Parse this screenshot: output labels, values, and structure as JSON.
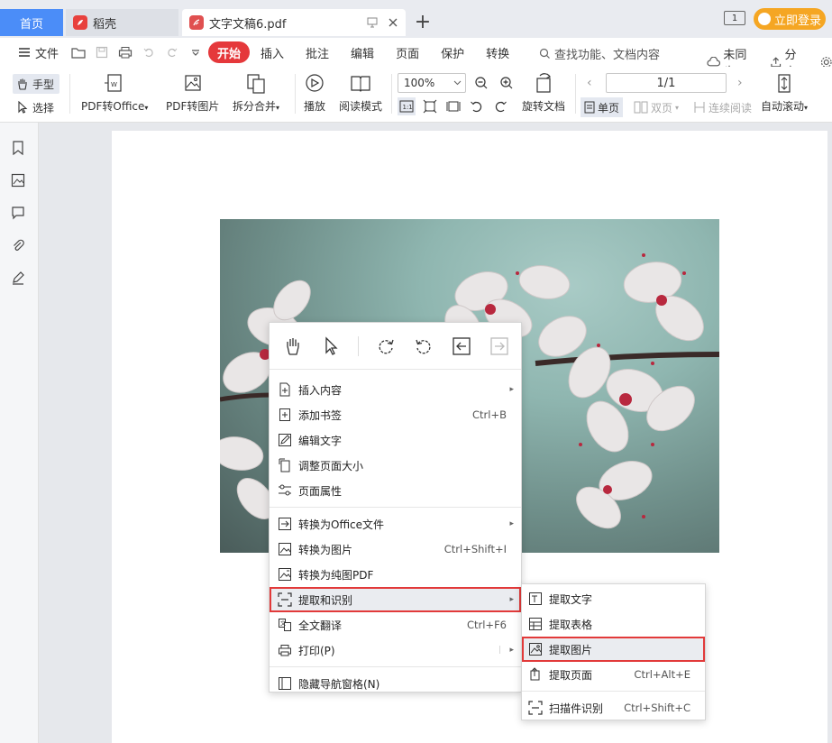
{
  "tabs": {
    "home": "首页",
    "daoke": "稻壳",
    "doc": "文字文稿6.pdf",
    "badge": "1",
    "login": "立即登录"
  },
  "menu": {
    "file": "文件",
    "tabs": [
      "开始",
      "插入",
      "批注",
      "编辑",
      "页面",
      "保护",
      "转换"
    ],
    "search": "查找功能、文档内容",
    "sync": "未同步",
    "share": "分享"
  },
  "toolbar": {
    "hand": "手型",
    "select": "选择",
    "pdf_to_office": "PDF转Office",
    "pdf_to_image": "PDF转图片",
    "split_merge": "拆分合并",
    "play": "播放",
    "read_mode": "阅读模式",
    "zoom": "100%",
    "rotate": "旋转文档",
    "page": "1/1",
    "single": "单页",
    "double": "双页",
    "continuous": "连续阅读",
    "auto_scroll": "自动滚动"
  },
  "context_menu": {
    "items": [
      {
        "label": "插入内容",
        "shortcut": "",
        "arrow": true
      },
      {
        "label": "添加书签",
        "shortcut": "Ctrl+B",
        "arrow": false
      },
      {
        "label": "编辑文字",
        "shortcut": "",
        "arrow": false
      },
      {
        "label": "调整页面大小",
        "shortcut": "",
        "arrow": false
      },
      {
        "label": "页面属性",
        "shortcut": "",
        "arrow": false
      },
      {
        "label": "转换为Office文件",
        "shortcut": "",
        "arrow": true
      },
      {
        "label": "转换为图片",
        "shortcut": "Ctrl+Shift+I",
        "arrow": false
      },
      {
        "label": "转换为纯图PDF",
        "shortcut": "",
        "arrow": false
      },
      {
        "label": "提取和识别",
        "shortcut": "",
        "arrow": true
      },
      {
        "label": "全文翻译",
        "shortcut": "Ctrl+F6",
        "arrow": false
      },
      {
        "label": "打印(P)",
        "shortcut": "",
        "arrow": true
      },
      {
        "label": "隐藏导航窗格(N)",
        "shortcut": "",
        "arrow": false
      }
    ]
  },
  "submenu": {
    "items": [
      {
        "label": "提取文字",
        "shortcut": ""
      },
      {
        "label": "提取表格",
        "shortcut": ""
      },
      {
        "label": "提取图片",
        "shortcut": ""
      },
      {
        "label": "提取页面",
        "shortcut": "Ctrl+Alt+E"
      },
      {
        "label": "扫描件识别",
        "shortcut": "Ctrl+Shift+C"
      }
    ]
  },
  "colors": {
    "accent_red": "#e5383b",
    "tab_blue": "#4b8df8",
    "login_orange": "#f5a623",
    "highlight_outline": "#e23a3a"
  }
}
